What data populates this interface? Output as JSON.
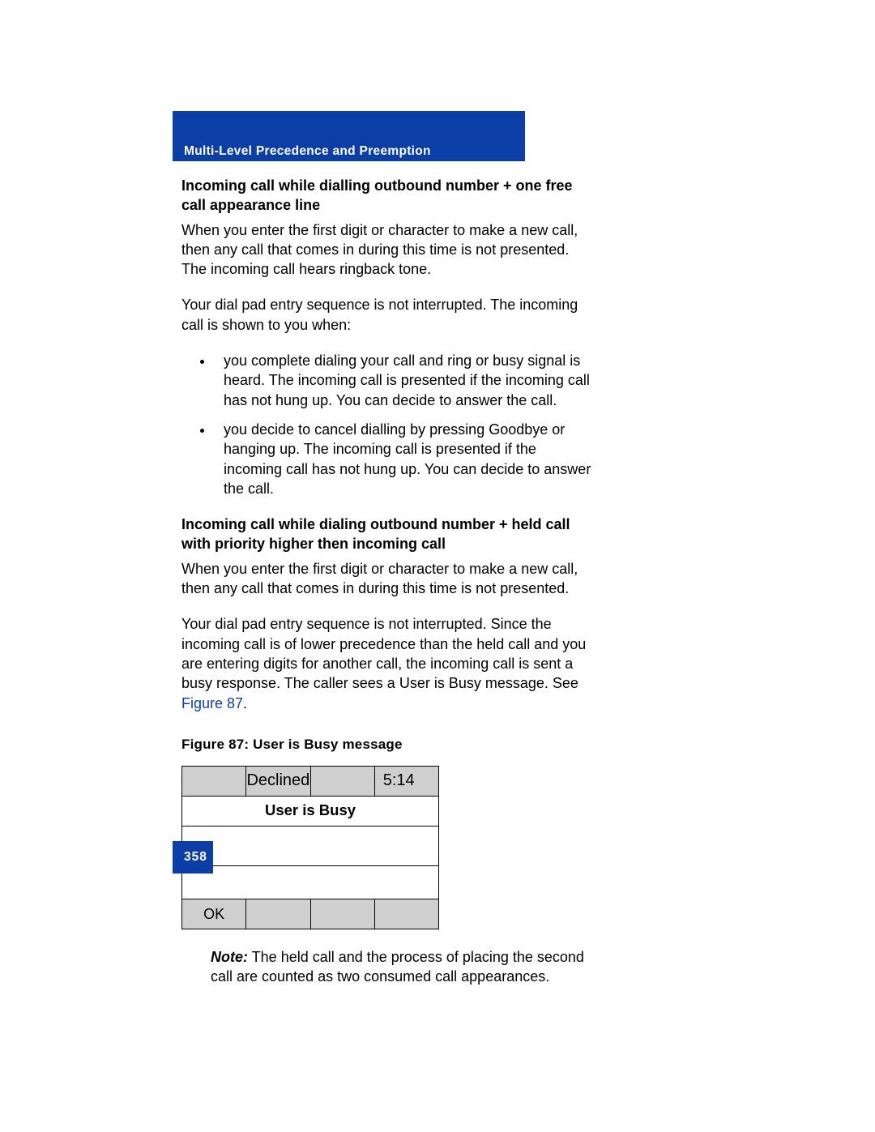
{
  "header": {
    "section_title": "Multi-Level Precedence and Preemption"
  },
  "section1": {
    "heading": "Incoming call while dialling outbound number + one free call appearance line",
    "p1": "When you enter the first digit or character to make a new call, then any call that comes in during this time is not presented. The incoming call hears ringback tone.",
    "p2": "Your dial pad entry sequence is not interrupted. The incoming call is shown to you when:",
    "bullets": [
      "you complete dialing your call and ring or busy signal is heard. The incoming call is presented if the incoming call has not hung up. You can decide to answer the call.",
      "you decide to cancel dialling by pressing Goodbye or hanging up. The incoming call is presented if the incoming call has not hung up. You can decide to answer the call."
    ]
  },
  "section2": {
    "heading": "Incoming call while dialing outbound number + held call with priority higher then incoming call",
    "p1": "When you enter the first digit or character to make a new call, then any call that comes in during this time is not presented.",
    "p2a": "Your dial pad entry sequence is not interrupted. Since the incoming call is of lower precedence than the held call and you are entering digits for another call, the incoming call is sent a busy response. The caller sees a User is Busy message. See ",
    "p2_link": "Figure 87",
    "p2b": "."
  },
  "figure": {
    "caption": "Figure 87: User is Busy message",
    "status": "Declined",
    "time": "5:14",
    "message": "User is Busy",
    "softkey1": "OK"
  },
  "note": {
    "label": "Note:",
    "text": " The held call and the process of placing the second call are counted as two consumed call appearances."
  },
  "footer": {
    "page_number": "358"
  }
}
